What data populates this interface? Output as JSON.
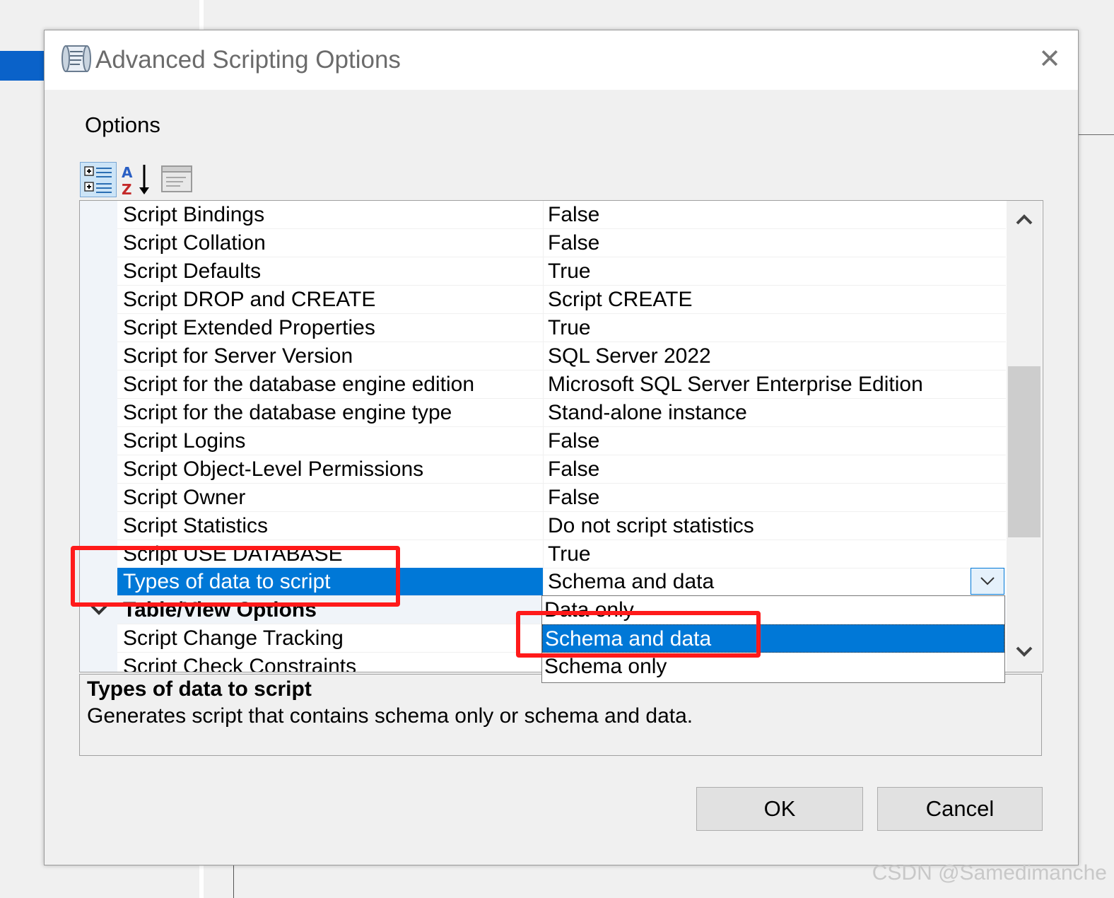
{
  "window": {
    "title": "Advanced Scripting Options"
  },
  "options_label": "Options",
  "toolbar": {
    "categorized_icon": "categorized-icon",
    "alphabetical_icon": "alphabetical-sort-icon",
    "property_pages_icon": "property-pages-icon"
  },
  "rows": [
    {
      "name": "Script Bindings",
      "value": "False"
    },
    {
      "name": "Script Collation",
      "value": "False"
    },
    {
      "name": "Script Defaults",
      "value": "True"
    },
    {
      "name": "Script DROP and CREATE",
      "value": "Script CREATE"
    },
    {
      "name": "Script Extended Properties",
      "value": "True"
    },
    {
      "name": "Script for Server Version",
      "value": "SQL Server 2022"
    },
    {
      "name": "Script for the database engine edition",
      "value": "Microsoft SQL Server Enterprise Edition"
    },
    {
      "name": "Script for the database engine type",
      "value": "Stand-alone instance"
    },
    {
      "name": "Script Logins",
      "value": "False"
    },
    {
      "name": "Script Object-Level Permissions",
      "value": "False"
    },
    {
      "name": "Script Owner",
      "value": "False"
    },
    {
      "name": "Script Statistics",
      "value": "Do not script statistics"
    },
    {
      "name": "Script USE DATABASE",
      "value": "True"
    },
    {
      "name": "Types of data to script",
      "value": "Schema and data"
    },
    {
      "name": "Table/View Options",
      "value": ""
    },
    {
      "name": "Script Change Tracking",
      "value": ""
    },
    {
      "name": "Script Check Constraints",
      "value": ""
    }
  ],
  "dropdown": {
    "options": [
      "Data only",
      "Schema and data",
      "Schema only"
    ],
    "selected": "Schema and data"
  },
  "description": {
    "title": "Types of data to script",
    "text": "Generates script that contains schema only or schema and data."
  },
  "buttons": {
    "ok": "OK",
    "cancel": "Cancel"
  },
  "watermark": "CSDN @Samedimanche",
  "colors": {
    "selection": "#0078d7",
    "annotation": "#ff1a1a"
  }
}
